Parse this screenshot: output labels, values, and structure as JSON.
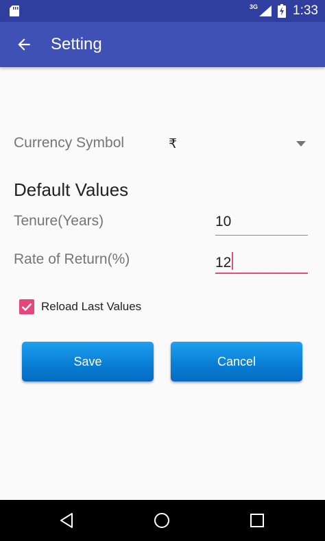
{
  "status_bar": {
    "network_label": "3G",
    "time": "1:33",
    "icons": [
      "sd-card-icon",
      "signal-icon",
      "battery-charging-icon"
    ]
  },
  "app_bar": {
    "title": "Setting",
    "back_icon": "arrow-back-icon"
  },
  "currency": {
    "label": "Currency Symbol",
    "value": "₹",
    "dropdown_icon": "triangle-down-icon"
  },
  "defaults": {
    "section_title": "Default Values",
    "tenure": {
      "label": "Tenure(Years)",
      "value": "10"
    },
    "rate": {
      "label": "Rate of Return(%)",
      "value": "12"
    }
  },
  "reload": {
    "label": "Reload Last Values",
    "checked": true
  },
  "buttons": {
    "save": "Save",
    "cancel": "Cancel"
  },
  "nav_bar": {
    "icons": [
      "nav-back-icon",
      "nav-home-icon",
      "nav-recent-icon"
    ]
  },
  "colors": {
    "status_bar": "#303f9f",
    "app_bar": "#3f51b5",
    "accent": "#e8457d",
    "button": "#0a7fd6"
  }
}
